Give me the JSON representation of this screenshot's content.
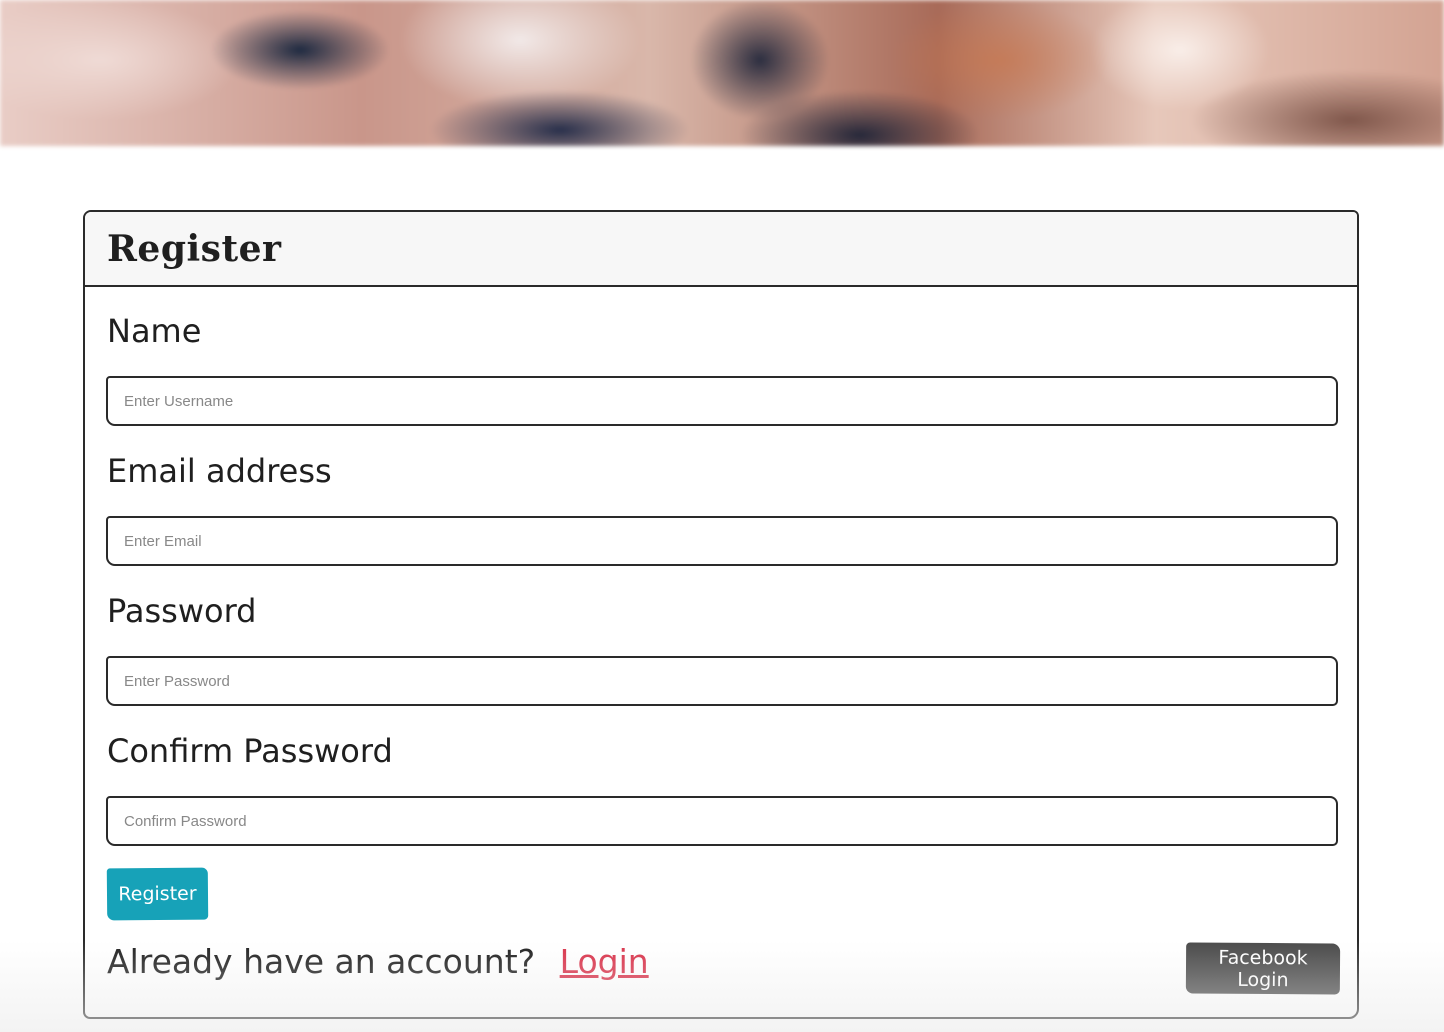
{
  "hero": {
    "image": "blurred-cafe-background"
  },
  "form": {
    "title": "Register",
    "fields": [
      {
        "label": "Name",
        "placeholder": "Enter Username",
        "value": ""
      },
      {
        "label": "Email address",
        "placeholder": "Enter Email",
        "value": ""
      },
      {
        "label": "Password",
        "placeholder": "Enter Password",
        "value": ""
      },
      {
        "label": "Confirm Password",
        "placeholder": "Confirm Password",
        "value": ""
      }
    ],
    "submit_label": "Register",
    "login_prompt": "Already have an account?",
    "login_link": "Login",
    "facebook_label": "Facebook Login"
  },
  "colors": {
    "register_button": "#17a2b8",
    "login_link": "#d9324a",
    "facebook_button": "#4a4a4a",
    "border": "#2a2a2a",
    "header_bg": "#f7f7f7"
  }
}
